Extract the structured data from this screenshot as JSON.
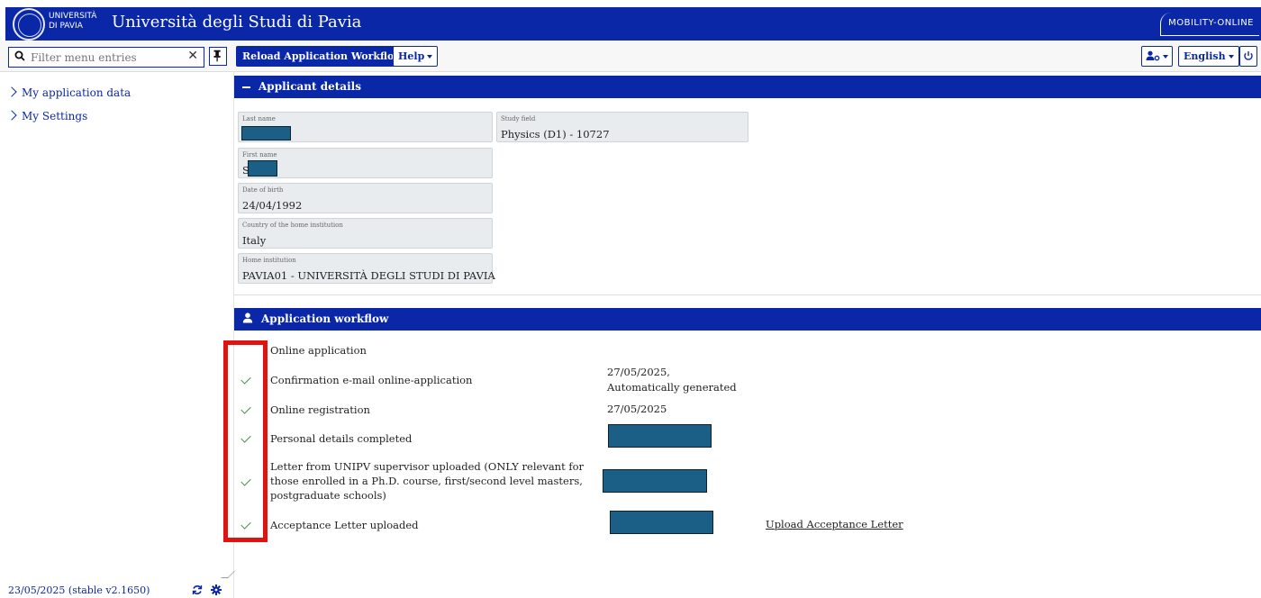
{
  "header": {
    "logo_text_line1": "UNIVERSITÀ",
    "logo_text_line2": "DI PAVIA",
    "title": "Università degli Studi di Pavia",
    "brand": "MOBILITY-ONLINE"
  },
  "toolbar": {
    "filter_placeholder": "Filter menu entries",
    "reload_label": "Reload Application Workflow",
    "help_label": "Help",
    "language_label": "English"
  },
  "sidebar": {
    "items": [
      {
        "label": "My application data"
      },
      {
        "label": "My Settings"
      }
    ],
    "version": "23/05/2025 (stable v2.1650)"
  },
  "applicant": {
    "section_title": "Applicant details",
    "fields": {
      "last_name": {
        "label": "Last name",
        "value": ""
      },
      "first_name": {
        "label": "First name",
        "value": "S"
      },
      "dob": {
        "label": "Date of birth",
        "value": "24/04/1992"
      },
      "country": {
        "label": "Country of the home institution",
        "value": "Italy"
      },
      "home_inst": {
        "label": "Home institution",
        "value": "PAVIA01 - UNIVERSITÀ DEGLI STUDI DI PAVIA"
      },
      "study_field": {
        "label": "Study field",
        "value": "Physics (D1) - 10727"
      }
    }
  },
  "workflow": {
    "section_title": "Application workflow",
    "steps": [
      {
        "label": "Online application",
        "done": false,
        "date": ""
      },
      {
        "label": "Confirmation e-mail online-application",
        "done": true,
        "date": "27/05/2025,",
        "date2": "Automatically generated"
      },
      {
        "label": "Online registration",
        "done": true,
        "date": "27/05/2025"
      },
      {
        "label": "Personal details completed",
        "done": true,
        "date": ""
      },
      {
        "label": "Letter from UNIPV supervisor uploaded (ONLY relevant for those enrolled in a Ph.D. course, first/second level masters, postgraduate schools)",
        "done": true,
        "date": ""
      },
      {
        "label": "Acceptance Letter uploaded",
        "done": true,
        "date": "",
        "action": "Upload Acceptance Letter"
      }
    ]
  },
  "colors": {
    "primary": "#0a27a8",
    "check": "#3b8f4d",
    "highlight": "#e01313",
    "redaction": "#1b5f86"
  }
}
